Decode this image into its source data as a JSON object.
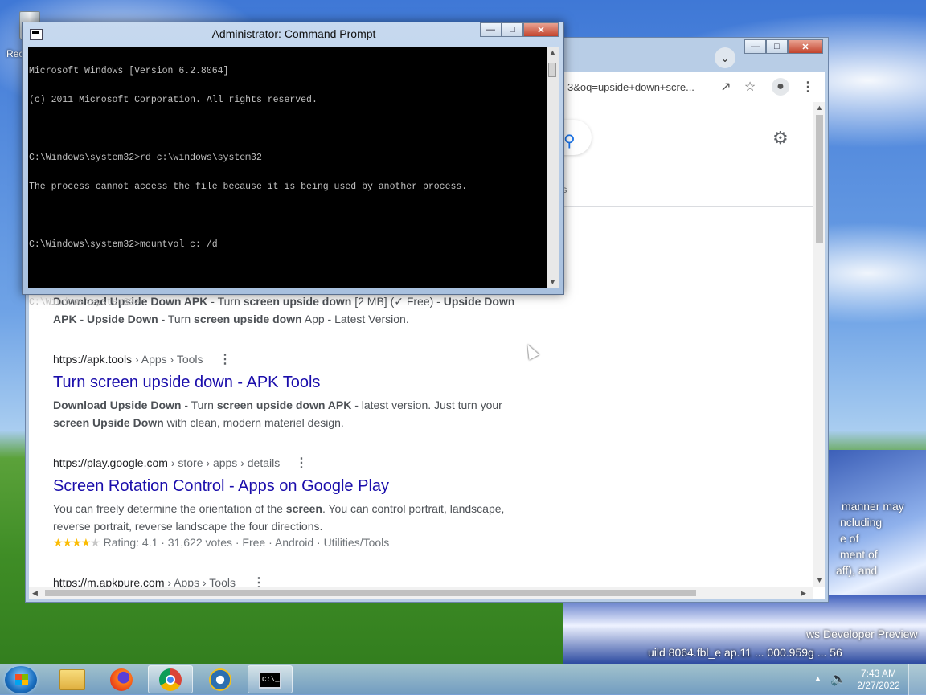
{
  "desktop": {
    "recycle_label": "Rec",
    "watermark_lines": [
      "ws Developer Preview",
      "uild 8064.fbl_e ap.11 ... 000.959g ... 56"
    ],
    "overlay_text": [
      "manner may",
      "ncluding",
      "e of",
      "ment of",
      "aff), and"
    ]
  },
  "cmd": {
    "title": "Administrator: Command Prompt",
    "lines": [
      "Microsoft Windows [Version 6.2.8064]",
      "(c) 2011 Microsoft Corporation. All rights reserved.",
      "",
      "C:\\Windows\\system32>rd c:\\windows\\system32",
      "The process cannot access the file because it is being used by another process.",
      "",
      "C:\\Windows\\system32>mountvol c: /d",
      "",
      "C:\\Windows\\system32>"
    ]
  },
  "browser": {
    "url_fragment": "3&oq=upside+down+scre...",
    "tools_fragment": "ols",
    "results": [
      {
        "snippet_html": "<b>Download Upside Down APK</b> - Turn <b>screen upside down</b> [2 MB] (✓ Free) - <b>Upside Down APK</b> - <b>Upside Down</b> - Turn <b>screen upside down</b> App - Latest Version."
      },
      {
        "cite_domain": "https://apk.tools",
        "cite_path": " › Apps › Tools",
        "title": "Turn screen upside down - APK Tools",
        "snippet_html": "<b>Download Upside Down</b> - Turn <b>screen upside down APK</b> - latest version. Just turn your <b>screen Upside Down</b> with clean, modern materiel design."
      },
      {
        "cite_domain": "https://play.google.com",
        "cite_path": " › store › apps › details",
        "title": "Screen Rotation Control - Apps on Google Play",
        "snippet_html": "You can freely determine the orientation of the <b>screen</b>. You can control portrait, landscape, reverse portrait, reverse landscape the four directions.",
        "stars": "★★★★",
        "star_empty": "★",
        "rating_text": " Rating: 4.1 · 31,622 votes · Free · Android · Utilities/Tools"
      },
      {
        "cite_domain": "https://m.apkpure.com",
        "cite_path": " › Apps › Tools"
      }
    ]
  },
  "taskbar": {
    "clock_time": "7:43 AM",
    "clock_date": "2/27/2022",
    "cmd_glyph": "C:\\_"
  }
}
